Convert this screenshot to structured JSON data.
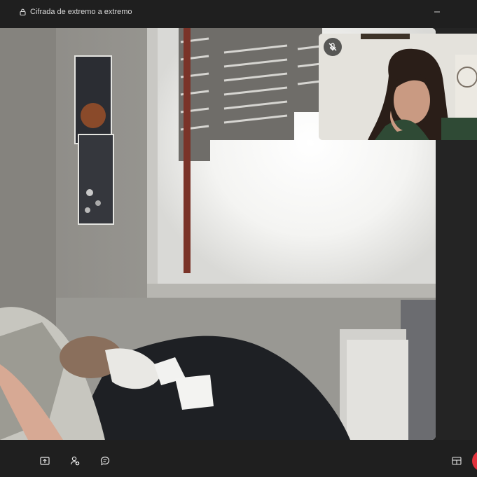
{
  "titlebar": {
    "encryption_label": "Cifrada de extremo a extremo",
    "lock_icon": "lock-icon",
    "minimize_icon": "minimize-icon"
  },
  "main_video": {
    "description_icon": "remote-video-feed"
  },
  "self_view": {
    "mute_icon": "mic-off-icon"
  },
  "toolbar": {
    "buttons": [
      {
        "icon": "share-screen-icon"
      },
      {
        "icon": "add-participant-icon"
      },
      {
        "icon": "chat-icon"
      },
      {
        "icon": "layout-icon"
      },
      {
        "icon": "end-call-icon"
      }
    ]
  },
  "colors": {
    "background": "#1f1f1f",
    "end_call": "#e0323c"
  }
}
